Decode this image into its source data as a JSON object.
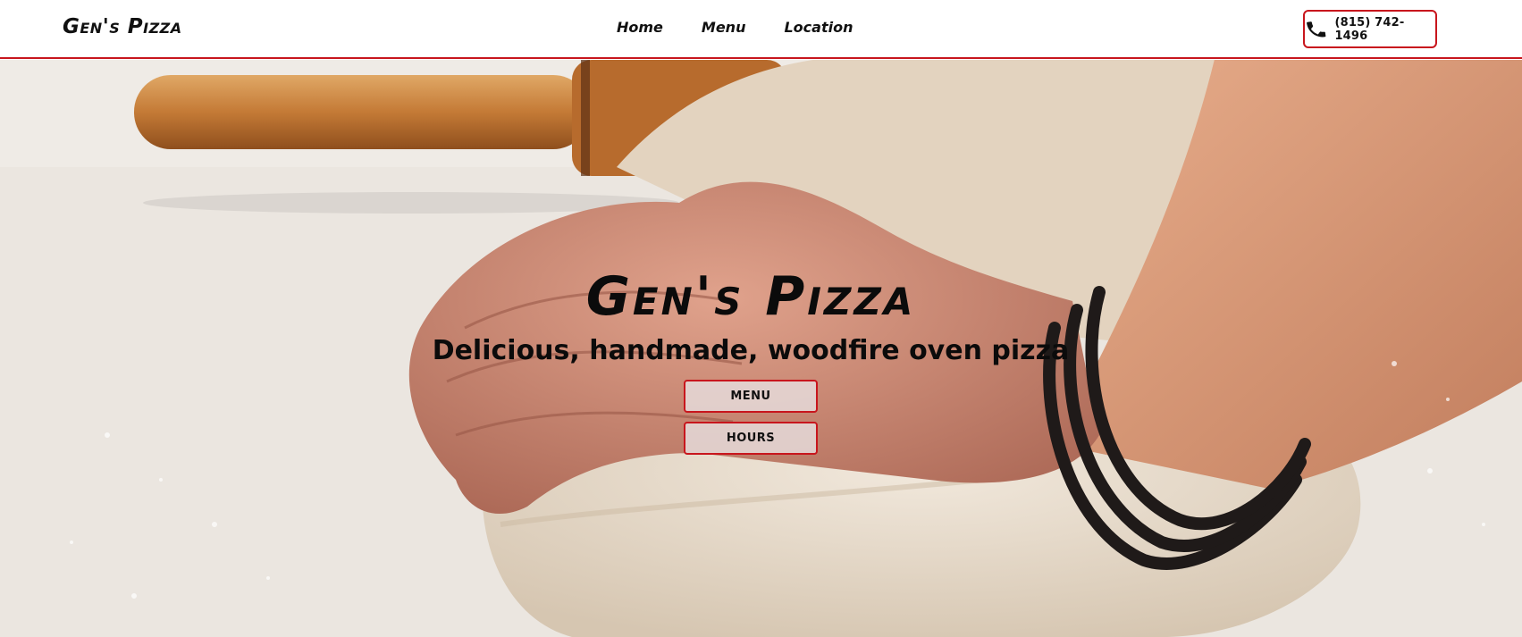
{
  "header": {
    "brand": "Gen's Pizza",
    "nav": [
      {
        "label": "Home"
      },
      {
        "label": "Menu"
      },
      {
        "label": "Location"
      }
    ],
    "phone": "(815) 742-1496"
  },
  "hero": {
    "title": "Gen's Pizza",
    "subtitle": "Delicious, handmade, woodfire oven pizza",
    "buttons": {
      "menu": "MENU",
      "hours": "HOURS"
    },
    "background_subject": "hands kneading pizza dough beside a rolling pin"
  },
  "colors": {
    "accent": "#c8161d",
    "text": "#111111"
  },
  "icons": {
    "phone": "phone-icon"
  }
}
